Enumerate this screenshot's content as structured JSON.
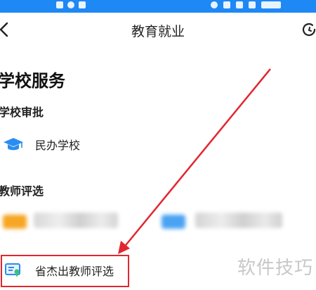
{
  "status_bar": {
    "background": "#1e88f5"
  },
  "header": {
    "title": "教育就业",
    "back_icon": "chevron-left-icon",
    "refresh_icon": "refresh-icon"
  },
  "section": {
    "title": "学校服务",
    "groups": [
      {
        "title": "学校审批",
        "items": [
          {
            "label": "民办学校",
            "icon": "graduation-cap-icon"
          }
        ]
      },
      {
        "title": "教师评选",
        "items": [
          {
            "label": "省杰出教师评选",
            "icon": "certificate-icon"
          }
        ]
      }
    ]
  },
  "watermark": "软件技巧",
  "colors": {
    "accent": "#1e88f5",
    "annotation": "#e2262f",
    "orange_icon": "#f6a623"
  }
}
